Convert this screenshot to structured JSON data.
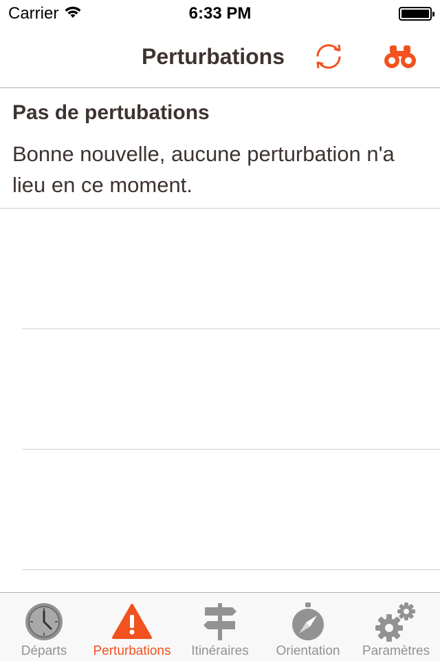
{
  "status": {
    "carrier": "Carrier",
    "time": "6:33 PM"
  },
  "nav": {
    "title": "Perturbations",
    "refresh_icon": "refresh-icon",
    "search_icon": "binoculars-icon"
  },
  "message": {
    "title": "Pas de pertubations",
    "body": "Bonne nouvelle, aucune perturbation n'a lieu en ce moment."
  },
  "tabs": [
    {
      "label": "Départs",
      "icon": "clock-icon",
      "active": false
    },
    {
      "label": "Perturbations",
      "icon": "warning-icon",
      "active": true
    },
    {
      "label": "Itinéraires",
      "icon": "signpost-icon",
      "active": false
    },
    {
      "label": "Orientation",
      "icon": "compass-icon",
      "active": false
    },
    {
      "label": "Paramètres",
      "icon": "gears-icon",
      "active": false
    }
  ],
  "colors": {
    "accent": "#f1521f",
    "text": "#3d3330",
    "inactive": "#929292"
  }
}
